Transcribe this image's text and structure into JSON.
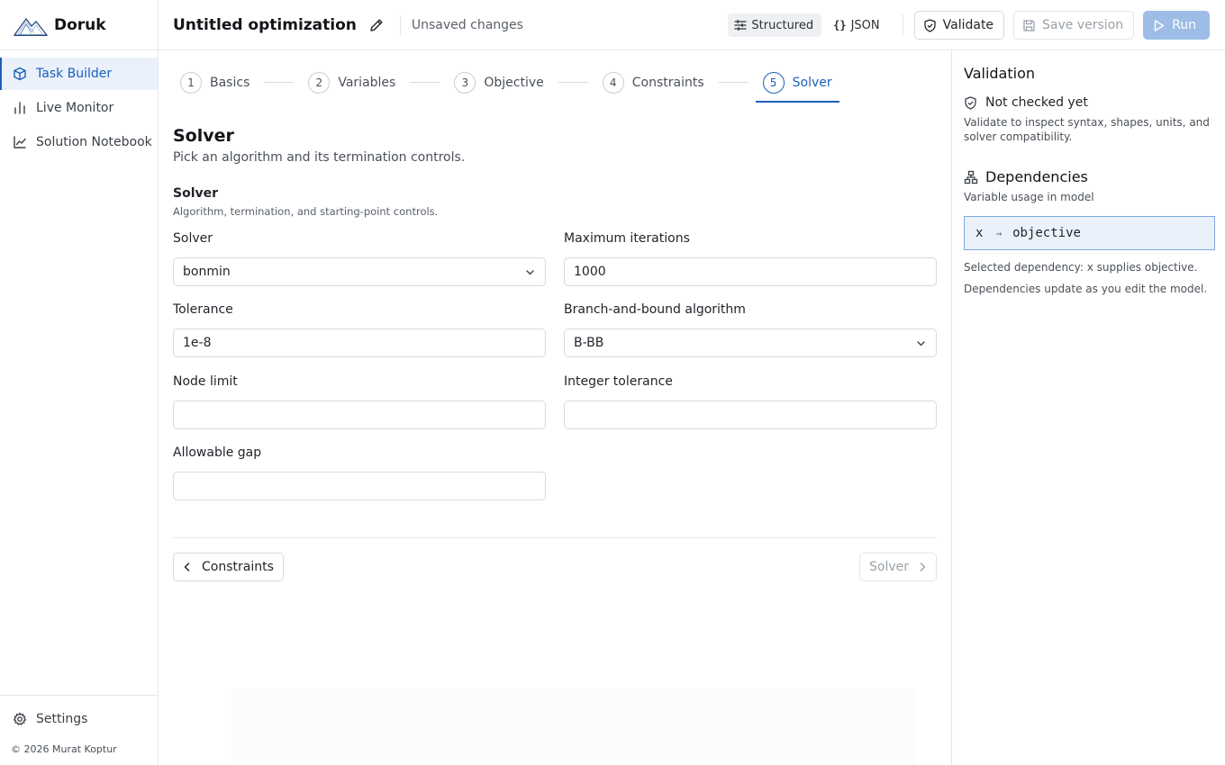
{
  "app": {
    "name": "Doruk",
    "logo_icon": "mountain-logo-icon"
  },
  "sidebar": {
    "items": [
      {
        "label": "Task Builder",
        "icon": "cube-icon",
        "active": true
      },
      {
        "label": "Live Monitor",
        "icon": "bar-chart-icon",
        "active": false
      },
      {
        "label": "Solution Notebook",
        "icon": "line-chart-icon",
        "active": false
      }
    ],
    "settings_label": "Settings",
    "copyright": "© 2026 Murat Koptur"
  },
  "header": {
    "title": "Untitled optimization",
    "status": "Unsaved changes",
    "mode_structured": "Structured",
    "mode_json": "JSON",
    "json_glyph": "{}",
    "validate_label": "Validate",
    "save_label": "Save version",
    "run_label": "Run"
  },
  "stepper": {
    "steps": [
      {
        "num": "1",
        "label": "Basics"
      },
      {
        "num": "2",
        "label": "Variables"
      },
      {
        "num": "3",
        "label": "Objective"
      },
      {
        "num": "4",
        "label": "Constraints"
      },
      {
        "num": "5",
        "label": "Solver"
      }
    ],
    "active_index": 4
  },
  "main": {
    "title": "Solver",
    "subtitle": "Pick an algorithm and its termination controls.",
    "section_title": "Solver",
    "section_subtitle": "Algorithm, termination, and starting-point controls.",
    "fields": {
      "solver": {
        "label": "Solver",
        "value": "bonmin"
      },
      "max_iter": {
        "label": "Maximum iterations",
        "value": "1000"
      },
      "tolerance": {
        "label": "Tolerance",
        "value": "1e-8"
      },
      "bb_algorithm": {
        "label": "Branch-and-bound algorithm",
        "value": "B-BB"
      },
      "node_limit": {
        "label": "Node limit",
        "value": ""
      },
      "integer_tolerance": {
        "label": "Integer tolerance",
        "value": ""
      },
      "allowable_gap": {
        "label": "Allowable gap",
        "value": ""
      }
    },
    "prev_label": "Constraints",
    "next_label": "Solver"
  },
  "validation": {
    "title": "Validation",
    "status": "Not checked yet",
    "description": "Validate to inspect syntax, shapes, units, and solver compatibility.",
    "dependencies_title": "Dependencies",
    "dependencies_subtitle": "Variable usage in model",
    "dependency": {
      "from": "x",
      "arrow": "→",
      "to": "objective"
    },
    "selected_text": "Selected dependency: x supplies objective.",
    "note": "Dependencies update as you edit the model."
  },
  "colors": {
    "accent": "#1d5fb8",
    "accent_bg": "#eaf1fb",
    "run_bg": "#9dbde6"
  }
}
